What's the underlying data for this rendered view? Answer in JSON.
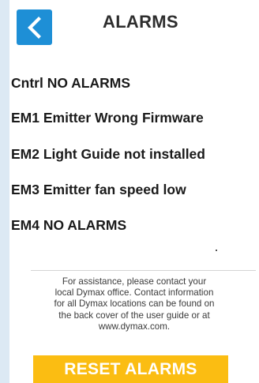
{
  "header": {
    "back_icon": "chevron-left-icon",
    "title": "ALARMS"
  },
  "alarms": [
    "Cntrl NO ALARMS",
    "EM1 Emitter Wrong Firmware",
    "EM2 Light Guide not installed",
    "EM3 Emitter fan speed low",
    "EM4 NO ALARMS"
  ],
  "help_lines": [
    "For assistance, please contact your",
    "local Dymax office. Contact information",
    "for all Dymax locations can be found on",
    "the back cover of the user guide or at",
    "www.dymax.com."
  ],
  "reset_button": {
    "label": "RESET ALARMS"
  },
  "colors": {
    "accent": "#1e8fd6",
    "reset": "#fbbd12",
    "background": "#dce9f4"
  }
}
